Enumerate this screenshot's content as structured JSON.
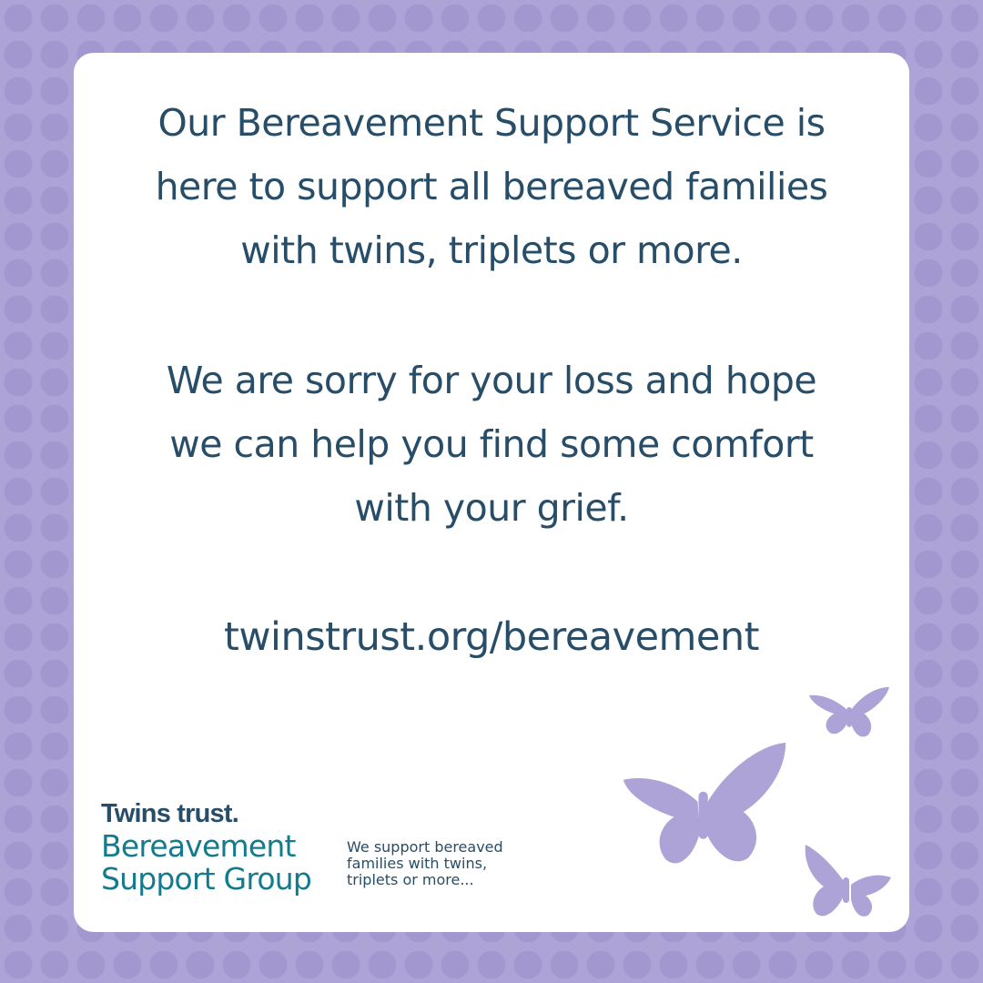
{
  "message": {
    "paragraph1": [
      "Our Bereavement Support Service is",
      "here to support all bereaved families",
      "with twins, triplets or more."
    ],
    "paragraph2": [
      "We are sorry for your loss and hope",
      "we can help you find some comfort",
      "with your grief."
    ],
    "url": "twinstrust.org/bereavement"
  },
  "logo": {
    "brand": "Twins trust.",
    "group_line1": "Bereavement",
    "group_line2": "Support Group"
  },
  "tagline": [
    "We support bereaved",
    "families with twins,",
    "triplets or more..."
  ],
  "colors": {
    "background": "#ada3d6",
    "dots": "#a298cf",
    "card": "#ffffff",
    "text_primary": "#274d68",
    "text_teal": "#137b8d",
    "butterfly": "#ada3d6"
  },
  "icons": [
    "butterfly-icon",
    "butterfly-icon",
    "butterfly-icon"
  ]
}
